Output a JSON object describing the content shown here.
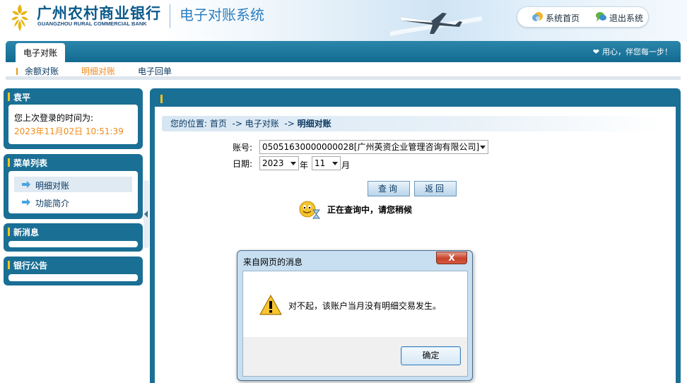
{
  "header": {
    "bank_name": "广州农村商业银行",
    "bank_name_en": "GUANGZHOU RURAL COMMERCIAL BANK",
    "system_title": "电子对账系统",
    "links": {
      "home": "系统首页",
      "logout": "退出系统"
    }
  },
  "nav": {
    "active_tab": "电子对账",
    "slogan": "用心，伴您每一步！",
    "sub_items": [
      "余额对账",
      "明细对账",
      "电子回单"
    ]
  },
  "sidebar": {
    "user_panel": {
      "title": "袁平",
      "last_login_label": "您上次登录的时间为:",
      "last_login_time": "2023年11月02日  10:51:39"
    },
    "menu_panel": {
      "title": "菜单列表",
      "items": [
        "明细对账",
        "功能简介"
      ]
    },
    "news_panel": {
      "title": "新消息"
    },
    "notice_panel": {
      "title": "银行公告"
    }
  },
  "main": {
    "breadcrumb": {
      "prefix": "您的位置:",
      "items": [
        "首页",
        "电子对账",
        "明细对账"
      ],
      "sep": "->"
    },
    "account_label": "账号:",
    "account_value": "05051630000000028[广州英资企业管理咨询有限公司]",
    "date_label": "日期:",
    "year_value": "2023",
    "year_unit": "年",
    "month_value": "11",
    "month_unit": "月",
    "query_button": "查询",
    "back_button": "返回",
    "loading_text": "正在查询中，请您稍候"
  },
  "dialog": {
    "title": "来自网页的消息",
    "close": "X",
    "message": "对不起，该账户当月没有明细交易发生。",
    "ok_button": "确定"
  },
  "colors": {
    "accent": "#1a6f95",
    "highlight": "#f08a1a",
    "marker": "#f5c518"
  }
}
